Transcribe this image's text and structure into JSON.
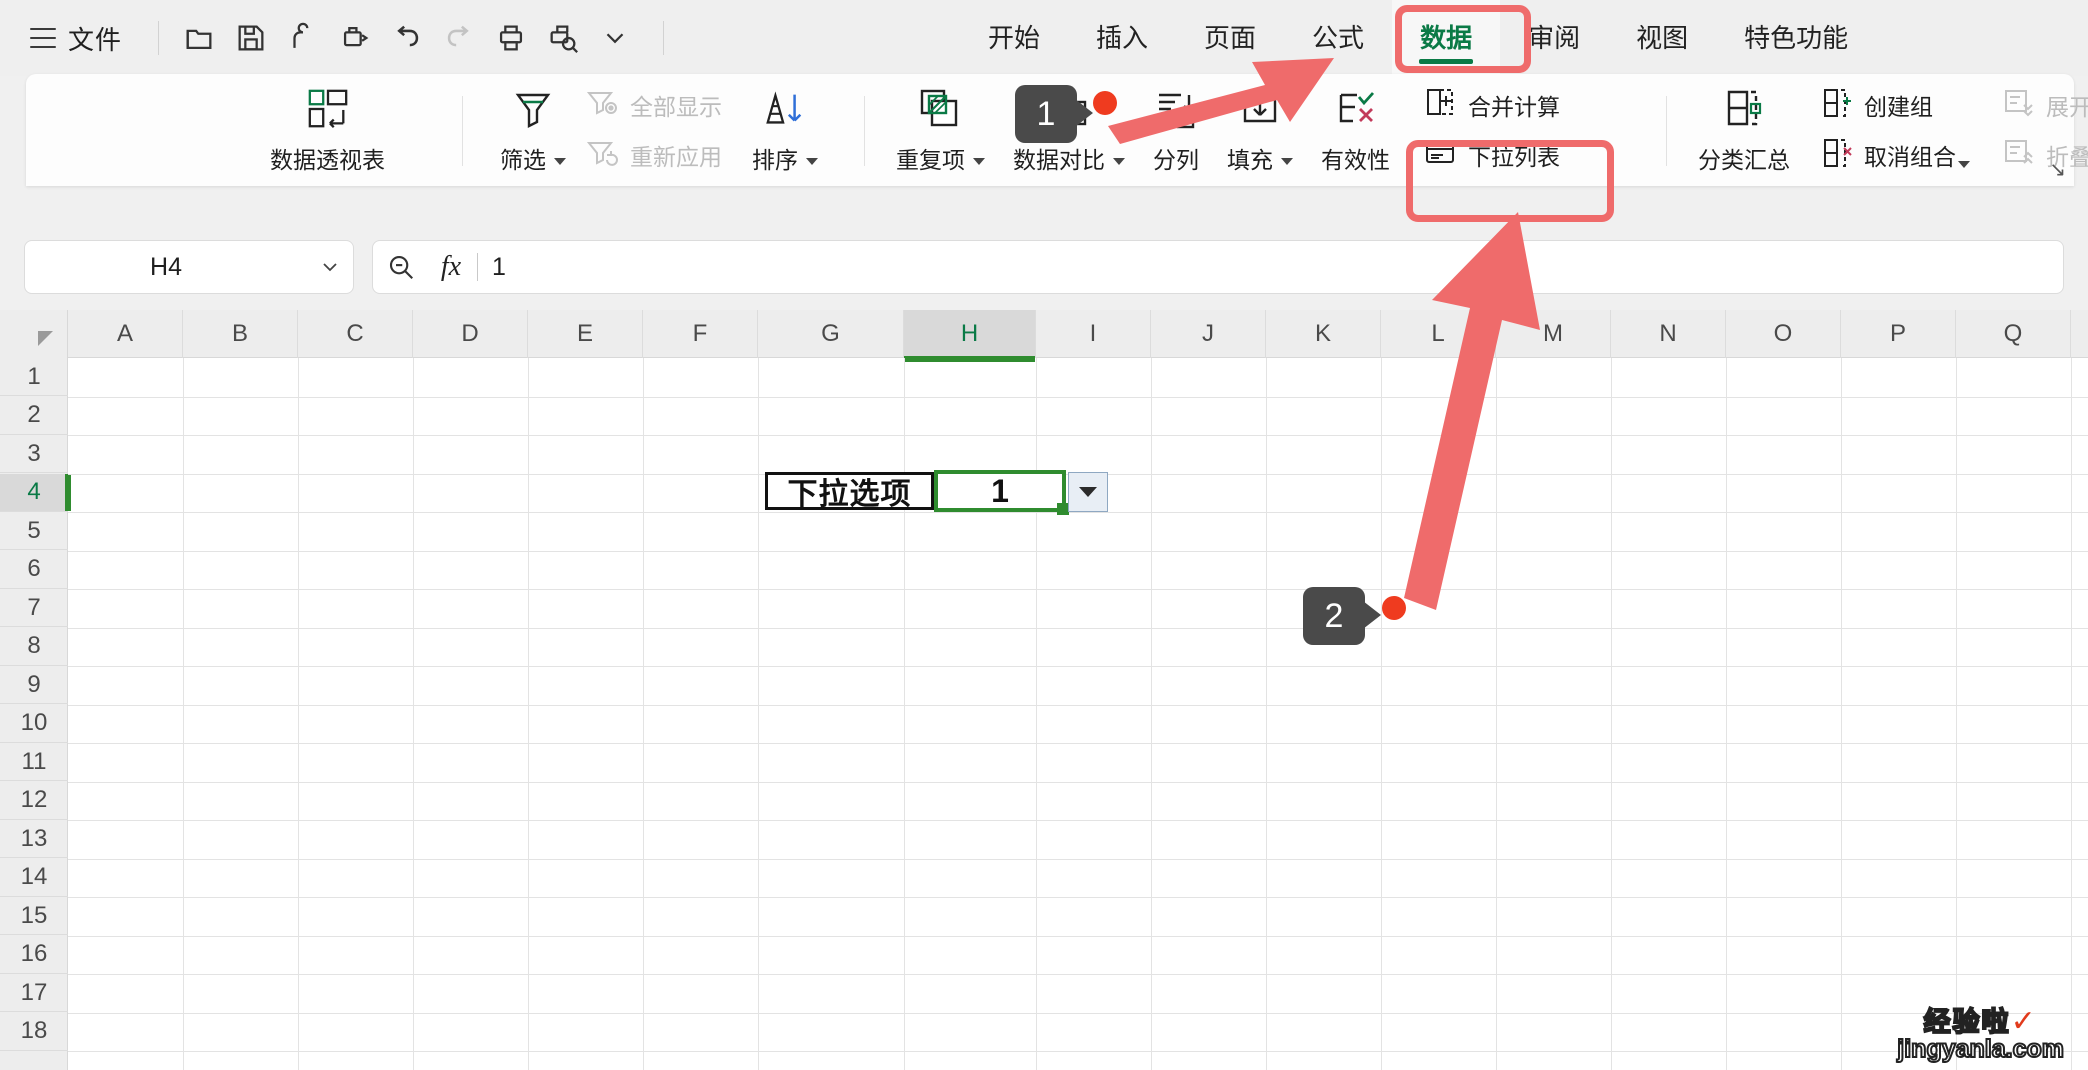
{
  "titlebar": {
    "menu_icon": "hamburger-icon",
    "file_label": "文件",
    "quick_icons": [
      "folder-open-icon",
      "save-icon",
      "share-icon",
      "print-preview-quick-icon",
      "undo-icon",
      "redo-icon",
      "print-icon",
      "print-find-icon",
      "more-chevron-icon"
    ]
  },
  "tabs": [
    {
      "label": "开始",
      "active": false
    },
    {
      "label": "插入",
      "active": false
    },
    {
      "label": "页面",
      "active": false
    },
    {
      "label": "公式",
      "active": false
    },
    {
      "label": "数据",
      "active": true
    },
    {
      "label": "审阅",
      "active": false
    },
    {
      "label": "视图",
      "active": false
    },
    {
      "label": "特色功能",
      "active": false
    }
  ],
  "ribbon": {
    "pivot": {
      "label": "数据透视表",
      "icon": "pivot-table-icon"
    },
    "filter": {
      "label": "筛选",
      "icon": "funnel-icon",
      "has_caret": true
    },
    "show_all": {
      "label": "全部显示",
      "icon": "funnel-eye-icon",
      "disabled": true
    },
    "reapply": {
      "label": "重新应用",
      "icon": "funnel-refresh-icon",
      "disabled": true
    },
    "sort": {
      "label": "排序",
      "icon": "sort-descending-icon",
      "has_caret": true
    },
    "duplicates": {
      "label": "重复项",
      "icon": "duplicate-items-icon",
      "has_caret": true
    },
    "compare": {
      "label": "数据对比",
      "icon": "data-compare-icon",
      "has_caret": true
    },
    "split_columns": {
      "label": "分列",
      "icon": "split-columns-icon"
    },
    "fill": {
      "label": "填充",
      "icon": "fill-down-icon",
      "has_caret": true
    },
    "validity": {
      "label": "有效性",
      "icon": "validity-check-icon"
    },
    "merge_calc": {
      "label": "合并计算",
      "icon": "merge-calc-icon"
    },
    "dropdown_list": {
      "label": "下拉列表",
      "icon": "dropdown-list-icon"
    },
    "subtotal": {
      "label": "分类汇总",
      "icon": "subtotal-icon"
    },
    "create_group": {
      "label": "创建组",
      "icon": "create-group-icon"
    },
    "ungroup": {
      "label": "取消组合",
      "icon": "ungroup-icon",
      "has_caret": true
    },
    "expand": {
      "label": "展开",
      "icon": "expand-rows-icon",
      "disabled": true
    },
    "collapse": {
      "label": "折叠",
      "icon": "collapse-rows-icon",
      "disabled": true
    },
    "dialog_launcher": "ribbon-expand-arrow"
  },
  "formula_bar": {
    "name_box_value": "H4",
    "name_box_caret": "chevron-down-icon",
    "zoom_icon": "search-minus-icon",
    "fx_label": "fx",
    "formula_value": "1"
  },
  "grid": {
    "columns": [
      "A",
      "B",
      "C",
      "D",
      "E",
      "F",
      "G",
      "H",
      "I",
      "J",
      "K",
      "L",
      "M",
      "N",
      "O",
      "P",
      "Q"
    ],
    "selected_column": "H",
    "rows": [
      "1",
      "2",
      "3",
      "4",
      "5",
      "6",
      "7",
      "8",
      "9",
      "10",
      "11",
      "12",
      "13",
      "14",
      "15",
      "16",
      "17",
      "18"
    ],
    "selected_row": "4",
    "label_cell": {
      "ref": "G4",
      "text": "下拉选项"
    },
    "active_cell": {
      "ref": "H4",
      "text": "1"
    },
    "dropdown_button_icon": "cell-dropdown-arrow-icon"
  },
  "annotations": [
    {
      "number": "1",
      "target": "数据对比 / 数据 tab"
    },
    {
      "number": "2",
      "target": "下拉列表"
    }
  ],
  "watermark": {
    "line1": "经验啦",
    "check": "✓",
    "line2": "jingyanla.com"
  },
  "colors": {
    "accent_green": "#0a7a46",
    "highlight_red": "#ef6b6b",
    "marker_dark": "#4a4a4a",
    "dot_red": "#ef3b1f",
    "selection_green": "#2f8c2f"
  }
}
